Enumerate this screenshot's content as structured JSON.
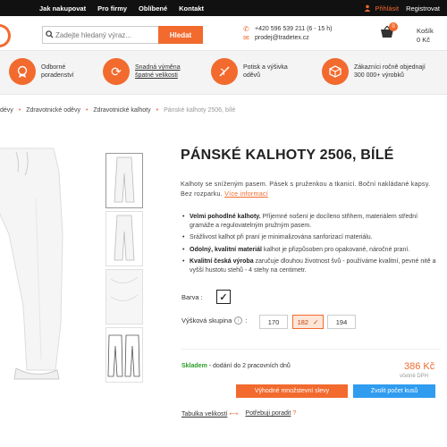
{
  "topbar": {
    "nav": [
      "Jak nakupovat",
      "Pro firmy",
      "Oblíbené",
      "Kontakt"
    ],
    "login": "Přihlásit",
    "register": "Registrovat"
  },
  "search": {
    "placeholder": "Zadejte hledaný výraz...",
    "button": "Hledat"
  },
  "contact": {
    "phone": "+420 596 539 211 (6 - 15 h)",
    "email": "prodej@tradetex.cz"
  },
  "cart": {
    "count": "0",
    "label": "Košík",
    "total": "0 Kč"
  },
  "features": [
    {
      "l1": "Odborné",
      "l2": "poradenství",
      "icon": "advice-icon"
    },
    {
      "l1": "Snadná výměna",
      "l2": "špatné velikosti",
      "icon": "exchange-icon"
    },
    {
      "l1": "Potisk a výšivka",
      "l2": "oděvů",
      "icon": "needle-icon"
    },
    {
      "l1": "Zákazníci ročně objednají",
      "l2": "300 000+ výrobků",
      "icon": "box-icon"
    }
  ],
  "breadcrumbs": [
    "dévy",
    "Zdravotnické oděvy",
    "Zdravotnické kalhoty",
    "Pánské kalhoty 2506, bílé"
  ],
  "product": {
    "title": "PÁNSKÉ KALHOTY 2506, BÍLÉ",
    "desc": "Kalhoty se sníženým pasem. Pásek s pruženkou a tkanicí. Boční nakládané kapsy. Bez rozparku.",
    "more": "Více informací",
    "bullets": [
      {
        "b": "Velmi pohodlné kalhoty.",
        "t": " Příjemné nošení je docíleno střihem, materiálem střední gramáže a regulovatelným pružným pasem."
      },
      {
        "b": "",
        "t": "Srážlivost kalhot při praní je minimalizována sanforizací materiálu."
      },
      {
        "b": "Odolný, kvalitní materiál",
        "t": " kalhot je přizpůsoben pro opakované, náročné praní."
      },
      {
        "b": "Kvalitní česká výroba",
        "t": " zaručuje dlouhou životnost švů - používáme kvalitní, pevné nitě a vyšší hustotu stehů - 4 stehy na centimetr."
      }
    ],
    "color_label": "Barva :",
    "size_label": "Výšková skupina",
    "sizes": [
      "170",
      "182",
      "194"
    ],
    "selected_size": "182",
    "stock_status": "Skladem",
    "stock_note": " - dodání do 2 pracovních dnů",
    "price": "386 Kč",
    "vat": "včetně DPH",
    "bulk_button": "Výhodné množstevní slevy",
    "qty_button": "Zvolit počet kusů",
    "size_table": "Tabulka velikostí",
    "need_advice": "Potřebuji poradit"
  },
  "colors": {
    "accent": "#f26a2e",
    "blue": "#2f9cf0",
    "green": "#2a9d2a"
  }
}
